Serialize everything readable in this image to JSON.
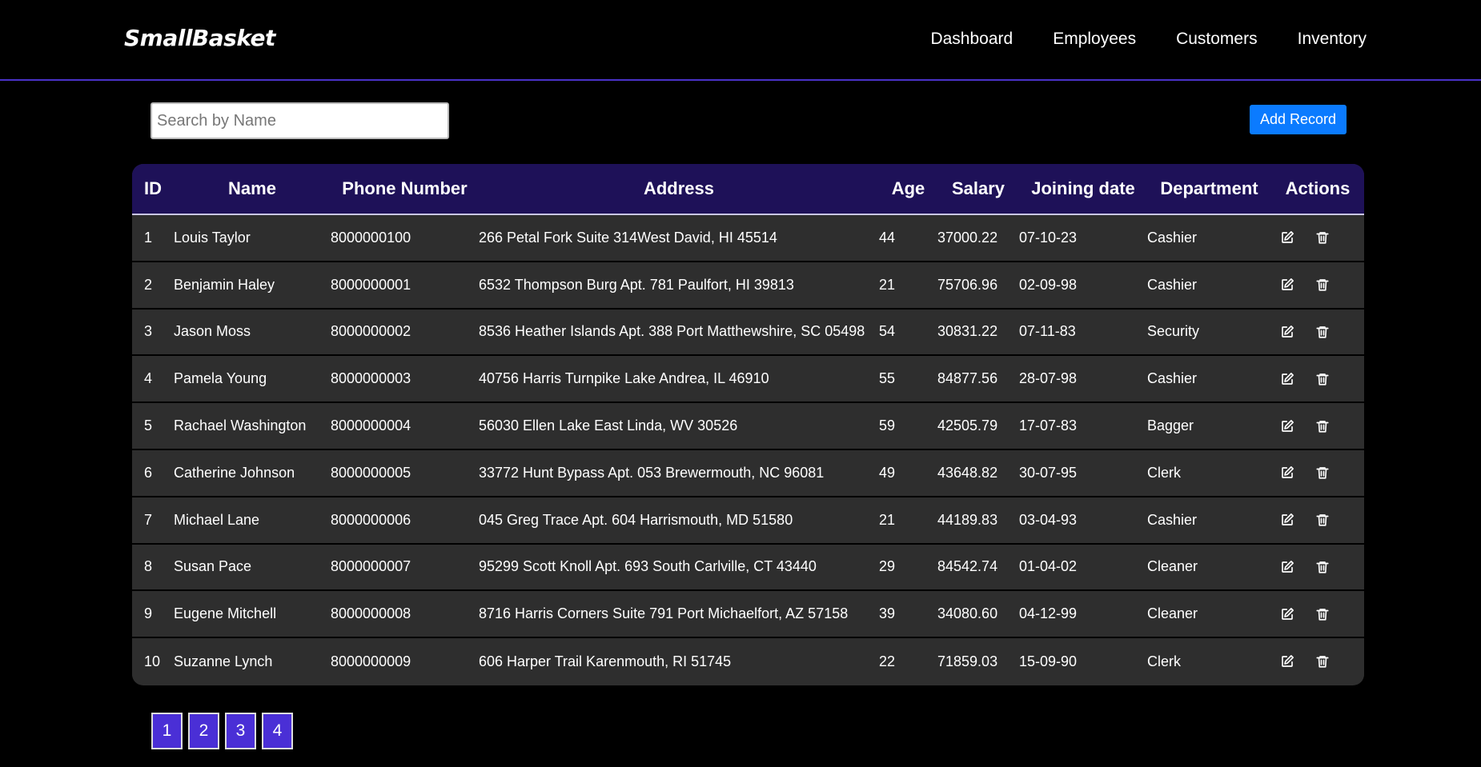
{
  "nav": {
    "brand": "SmallBasket",
    "links": [
      "Dashboard",
      "Employees",
      "Customers",
      "Inventory"
    ]
  },
  "search": {
    "placeholder": "Search by Name",
    "value": ""
  },
  "toolbar": {
    "add_label": "Add Record"
  },
  "table": {
    "headers": [
      "ID",
      "Name",
      "Phone Number",
      "Address",
      "Age",
      "Salary",
      "Joining date",
      "Department",
      "Actions"
    ],
    "rows": [
      [
        "1",
        "Louis Taylor",
        "8000000100",
        "266 Petal Fork Suite 314West David, HI 45514",
        "44",
        "37000.22",
        "07-10-23",
        "Cashier"
      ],
      [
        "2",
        "Benjamin Haley",
        "8000000001",
        "6532 Thompson Burg Apt. 781 Paulfort, HI 39813",
        "21",
        "75706.96",
        "02-09-98",
        "Cashier"
      ],
      [
        "3",
        "Jason Moss",
        "8000000002",
        "8536 Heather Islands Apt. 388 Port Matthewshire, SC 05498",
        "54",
        "30831.22",
        "07-11-83",
        "Security"
      ],
      [
        "4",
        "Pamela Young",
        "8000000003",
        "40756 Harris Turnpike Lake Andrea, IL 46910",
        "55",
        "84877.56",
        "28-07-98",
        "Cashier"
      ],
      [
        "5",
        "Rachael Washington",
        "8000000004",
        "56030 Ellen Lake East Linda, WV 30526",
        "59",
        "42505.79",
        "17-07-83",
        "Bagger"
      ],
      [
        "6",
        "Catherine Johnson",
        "8000000005",
        "33772 Hunt Bypass Apt. 053 Brewermouth, NC 96081",
        "49",
        "43648.82",
        "30-07-95",
        "Clerk"
      ],
      [
        "7",
        "Michael Lane",
        "8000000006",
        "045 Greg Trace Apt. 604 Harrismouth, MD 51580",
        "21",
        "44189.83",
        "03-04-93",
        "Cashier"
      ],
      [
        "8",
        "Susan Pace",
        "8000000007",
        "95299 Scott Knoll Apt. 693 South Carlville, CT 43440",
        "29",
        "84542.74",
        "01-04-02",
        "Cleaner"
      ],
      [
        "9",
        "Eugene Mitchell",
        "8000000008",
        "8716 Harris Corners Suite 791 Port Michaelfort, AZ 57158",
        "39",
        "34080.60",
        "04-12-99",
        "Cleaner"
      ],
      [
        "10",
        "Suzanne Lynch",
        "8000000009",
        "606 Harper Trail Karenmouth, RI 51745",
        "22",
        "71859.03",
        "15-09-90",
        "Clerk"
      ]
    ],
    "action_icons": [
      "edit-icon",
      "trash-icon"
    ]
  },
  "pagination": {
    "pages": [
      "1",
      "2",
      "3",
      "4"
    ]
  },
  "colors": {
    "background": "#000000",
    "header_bg": "#1e1158",
    "row_bg": "#2e2e2e",
    "accent": "#4a2fd6",
    "button": "#0b7bff"
  }
}
